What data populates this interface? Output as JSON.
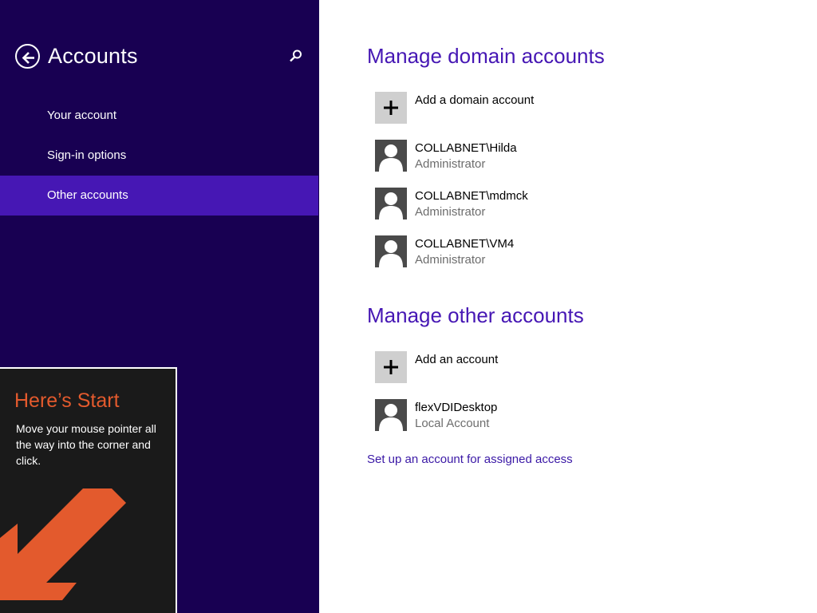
{
  "colors": {
    "left_pane_bg": "#180052",
    "selected_nav_bg": "#4617b4",
    "heading_accent": "#4617b4",
    "tip_title": "#e35a2d",
    "tip_arrow": "#e35a2d"
  },
  "left_pane": {
    "title": "Accounts",
    "back_icon": "back-arrow-circle-icon",
    "search_icon": "search-icon",
    "nav_items": [
      {
        "label": "Your account",
        "selected": false
      },
      {
        "label": "Sign-in options",
        "selected": false
      },
      {
        "label": "Other accounts",
        "selected": true
      }
    ]
  },
  "start_tip": {
    "title": "Here’s Start",
    "body": "Move your mouse pointer all the way into the corner and click."
  },
  "domain_accounts": {
    "heading": "Manage domain accounts",
    "add_label": "Add a domain account",
    "accounts": [
      {
        "name": "COLLABNET\\Hilda",
        "role": "Administrator"
      },
      {
        "name": "COLLABNET\\mdmck",
        "role": "Administrator"
      },
      {
        "name": "COLLABNET\\VM4",
        "role": "Administrator"
      }
    ]
  },
  "other_accounts": {
    "heading": "Manage other accounts",
    "add_label": "Add an account",
    "accounts": [
      {
        "name": "flexVDIDesktop",
        "role": "Local Account"
      }
    ]
  },
  "assigned_access_link": "Set up an account for assigned access"
}
